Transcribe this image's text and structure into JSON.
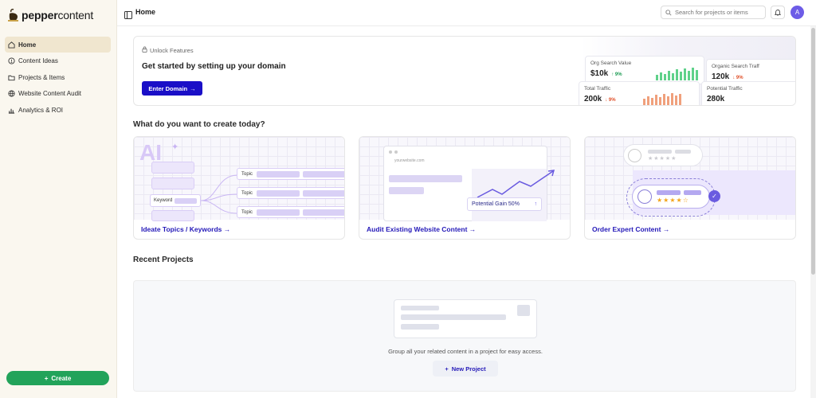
{
  "brand": {
    "logo_text_1": "pepper",
    "logo_text_2": "content"
  },
  "sidebar": {
    "items": [
      {
        "label": "Home",
        "icon": "home-icon"
      },
      {
        "label": "Content Ideas",
        "icon": "lightbulb-icon"
      },
      {
        "label": "Projects & Items",
        "icon": "folder-icon"
      },
      {
        "label": "Website Content Audit",
        "icon": "globe-icon"
      },
      {
        "label": "Analytics & ROI",
        "icon": "chart-icon"
      }
    ],
    "create_label": "Create"
  },
  "header": {
    "title": "Home",
    "search_placeholder": "Search for projects or items",
    "avatar_initial": "A"
  },
  "banner": {
    "unlock_label": "Unlock Features",
    "title": "Get started by setting up your domain",
    "button_label": "Enter Domain",
    "stats": [
      {
        "label": "Org Search Value",
        "value": "$10k",
        "change": "9%"
      },
      {
        "label": "Organic Search Traff",
        "value": "120k",
        "change": "9%"
      },
      {
        "label": "Total Traffic",
        "value": "200k",
        "change": "9%"
      },
      {
        "label": "Potential Traffic",
        "value": "280k"
      }
    ]
  },
  "create": {
    "heading": "What do you want to create today?",
    "cards": [
      {
        "label": "Ideate Topics / Keywords",
        "art_ai": "AI",
        "art_keyword": "Keyword",
        "art_topic": "Topic"
      },
      {
        "label": "Audit Existing Website Content",
        "art_url": "yourwebsite.com",
        "art_gain": "Potential Gain 50%"
      },
      {
        "label": "Order Expert Content"
      }
    ]
  },
  "recent": {
    "heading": "Recent Projects",
    "empty_text": "Group all your related content in a project for easy access.",
    "new_project_label": "New Project"
  },
  "colors": {
    "primary": "#1a0fc7",
    "create_green": "#22a35a",
    "sidebar_bg": "#faf7ef",
    "link_purple": "#2419b8"
  }
}
